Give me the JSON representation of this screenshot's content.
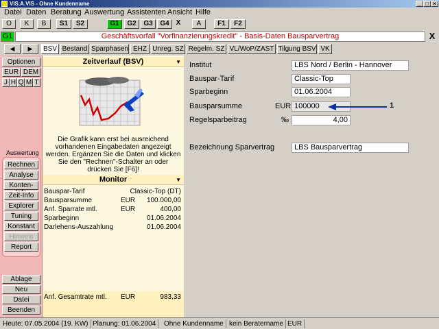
{
  "window": {
    "title": "VIS.A.VIS - Ohne Kundenname"
  },
  "menu": [
    "Datei",
    "Daten",
    "Beratung",
    "Auswertung",
    "Assistenten",
    "Ansicht",
    "Hilfe"
  ],
  "toolbar": {
    "o": "O",
    "k": "K",
    "b": "B",
    "s1": "S1",
    "s2": "S2",
    "g1": "G1",
    "g2": "G2",
    "g3": "G3",
    "g4": "G4",
    "x": "X",
    "a": "A",
    "f1": "F1",
    "f2": "F2"
  },
  "header": {
    "badge": "G1",
    "title": "Geschäftsvorfall \"Vorfinanzierungskredit\" - Basis-Daten Bausparvertrag",
    "close": "X"
  },
  "tabs": [
    "BSV",
    "Bestand",
    "Sparphasen",
    "EHZ",
    "Unreg. SZ",
    "Regelm. SZ",
    "VL/WoP/ZAST",
    "Tilgung BSV",
    "VK"
  ],
  "nav": {
    "prev": "◀",
    "next": "▶"
  },
  "sidebar": {
    "optionen": "Optionen",
    "eur": "EUR",
    "dem": "DEM",
    "periods": [
      "J",
      "H",
      "Q",
      "M",
      "T"
    ],
    "auswertung_label": "Auswertung",
    "group": [
      "Rechnen",
      "Analyse",
      "Konten-Info",
      "Zeit-Info",
      "Explorer",
      "Tuning",
      "Konstant",
      "Hinweis",
      "Report"
    ],
    "bottom": [
      "Ablage",
      "Neu",
      "Datei",
      "Beenden"
    ]
  },
  "zeitverlauf": {
    "title": "Zeitverlauf (BSV)",
    "info": "Die Grafik kann erst bei ausreichend vorhandenen Eingabedaten angezeigt werden. Ergänzen Sie die Daten und klicken Sie den \"Rechnen\"-Schalter an oder drücken Sie [F6]!"
  },
  "monitor": {
    "title": "Monitor",
    "rows": [
      {
        "label": "Bauspar-Tarif",
        "unit": "",
        "value": "Classic-Top  (DT)"
      },
      {
        "label": "Bausparsumme",
        "unit": "EUR",
        "value": "100.000,00"
      },
      {
        "label": "Anf. Sparrate mtl.",
        "unit": "EUR",
        "value": "400,00"
      },
      {
        "label": "Sparbeginn",
        "unit": "",
        "value": "01.06.2004"
      },
      {
        "label": "Darlehens-Auszahlung",
        "unit": "",
        "value": "01.06.2004"
      }
    ],
    "total": {
      "label": "Anf. Gesamtrate mtl.",
      "unit": "EUR",
      "value": "983,33"
    }
  },
  "form": {
    "institut_label": "Institut",
    "institut_value": "LBS Nord / Berlin - Hannover",
    "tarif_label": "Bauspar-Tarif",
    "tarif_value": "Classic-Top",
    "sparbeginn_label": "Sparbeginn",
    "sparbeginn_value": "01.06.2004",
    "summe_label": "Bausparsumme",
    "summe_unit": "EUR",
    "summe_value": "100000",
    "annotation": "1",
    "regelspar_label": "Regelsparbeitrag",
    "regelspar_unit": "‰",
    "regelspar_value": "4,00",
    "bez_label": "Bezeichnung Sparvertrag",
    "bez_value": "LBS Bausparvertrag"
  },
  "status": [
    "Heute: 07.05.2004 (19. KW)",
    "Planung: 01.06.2004",
    "Ohne Kundenname",
    "kein Beratername",
    "EUR"
  ],
  "colors": {
    "accent_green": "#00d000",
    "sidebar_pink": "#f0b8b8",
    "header_red": "#c00000",
    "arrow_blue": "#1030a0"
  }
}
